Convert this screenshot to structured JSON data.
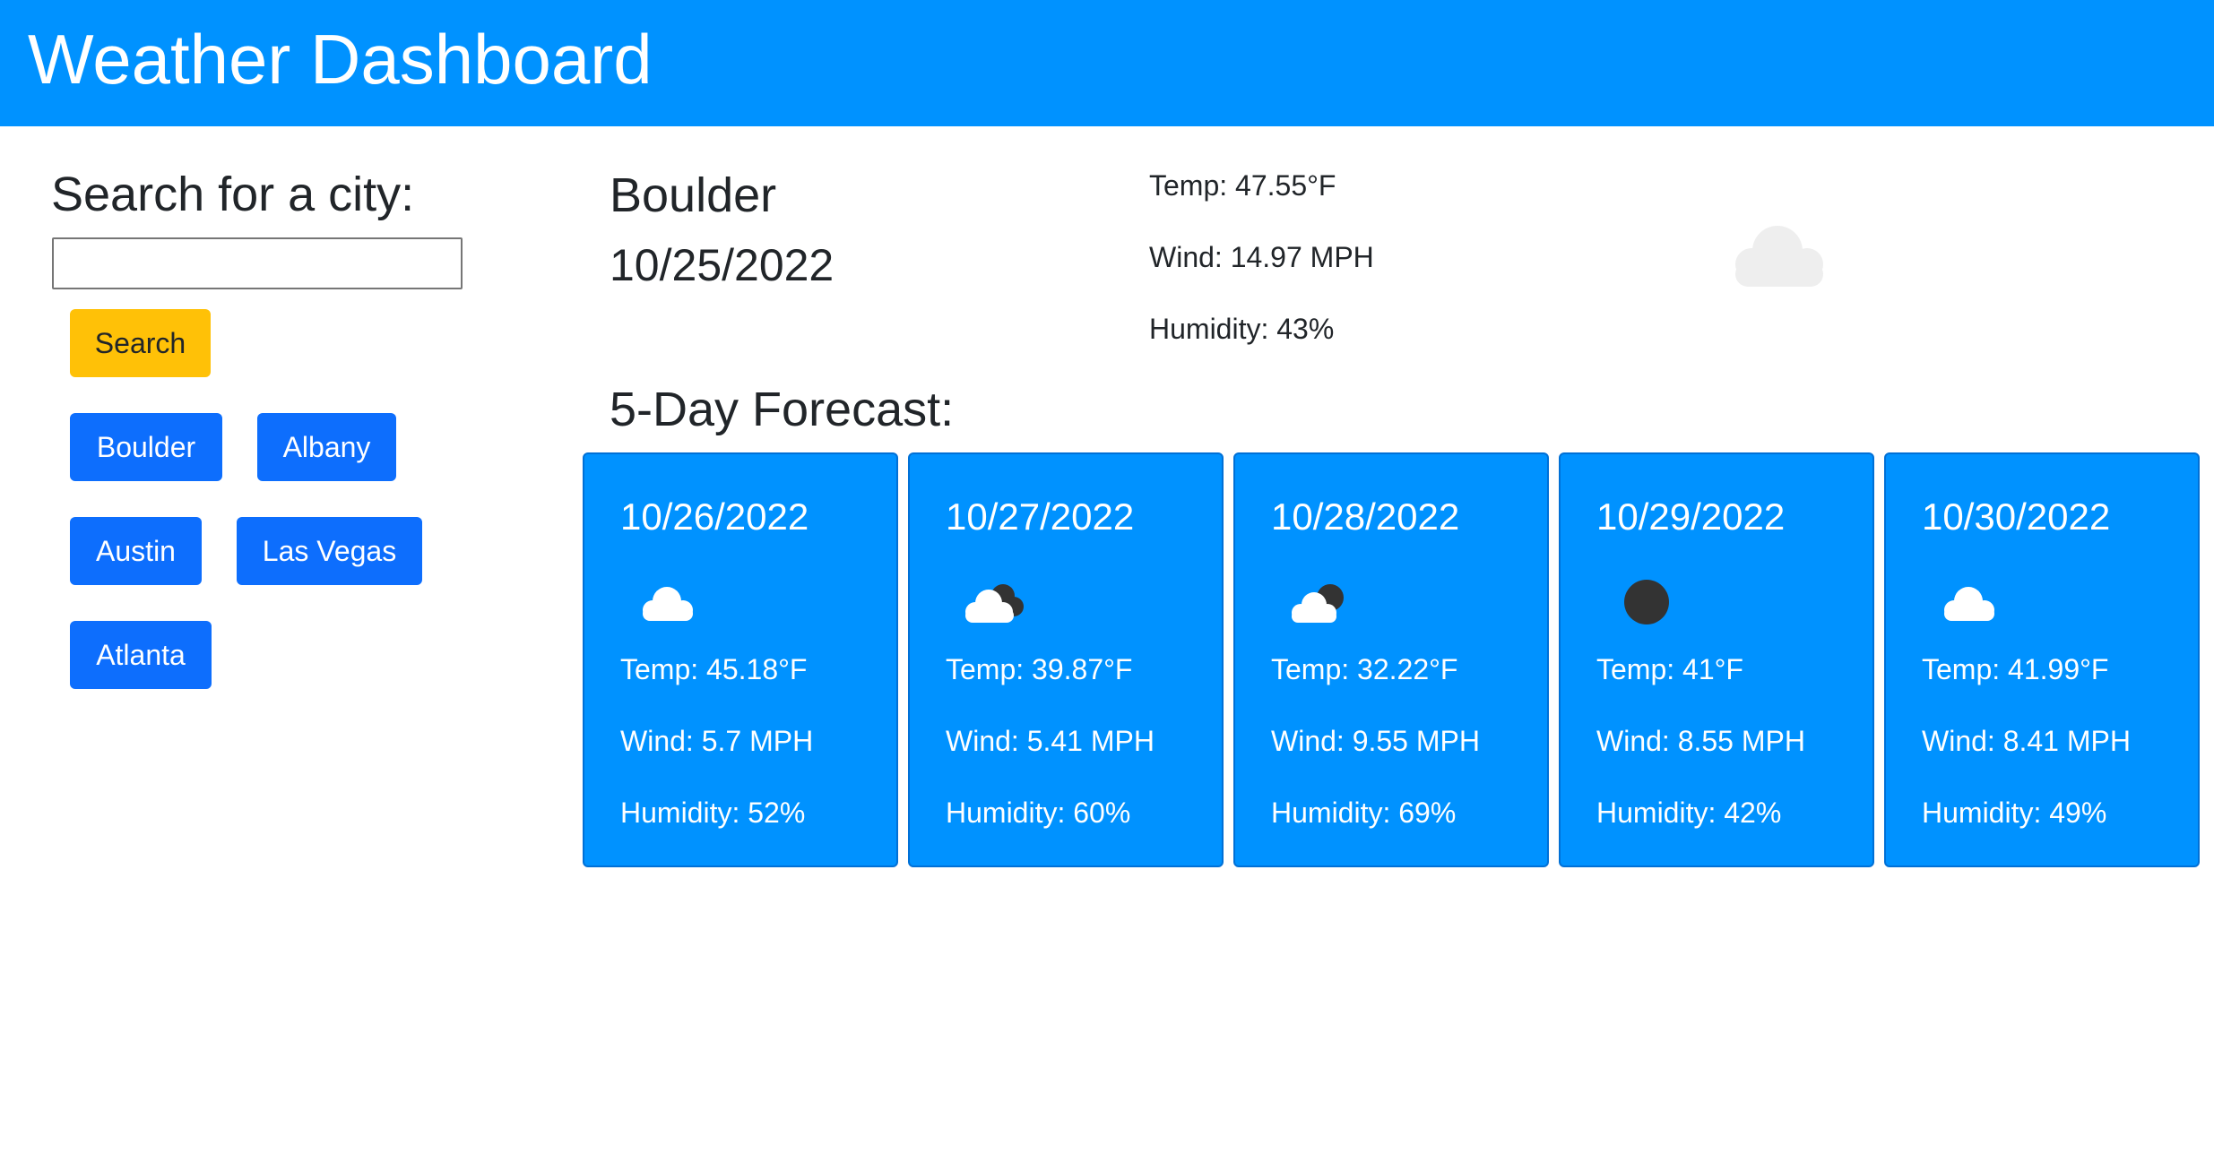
{
  "header": {
    "title": "Weather Dashboard"
  },
  "sidebar": {
    "search_title": "Search for a city:",
    "search_value": "",
    "search_button": "Search",
    "history": [
      "Boulder",
      "Albany",
      "Austin",
      "Las Vegas",
      "Atlanta"
    ]
  },
  "current": {
    "city": "Boulder",
    "date": "10/25/2022",
    "temp": "Temp: 47.55°F",
    "wind": "Wind: 14.97 MPH",
    "humidity": "Humidity: 43%",
    "icon": "cloud-icon"
  },
  "forecast": {
    "title": "5-Day Forecast:",
    "days": [
      {
        "date": "10/26/2022",
        "icon": "cloud-icon",
        "temp": "Temp: 45.18°F",
        "wind": "Wind: 5.7 MPH",
        "humidity": "Humidity: 52%"
      },
      {
        "date": "10/27/2022",
        "icon": "cloud-night-icon",
        "temp": "Temp: 39.87°F",
        "wind": "Wind: 5.41 MPH",
        "humidity": "Humidity: 60%"
      },
      {
        "date": "10/28/2022",
        "icon": "partly-cloudy-night-icon",
        "temp": "Temp: 32.22°F",
        "wind": "Wind: 9.55 MPH",
        "humidity": "Humidity: 69%"
      },
      {
        "date": "10/29/2022",
        "icon": "clear-night-icon",
        "temp": "Temp: 41°F",
        "wind": "Wind: 8.55 MPH",
        "humidity": "Humidity: 42%"
      },
      {
        "date": "10/30/2022",
        "icon": "cloud-icon",
        "temp": "Temp: 41.99°F",
        "wind": "Wind: 8.41 MPH",
        "humidity": "Humidity: 49%"
      }
    ]
  },
  "colors": {
    "header": "#0092ff",
    "card": "#0092ff",
    "city_button": "#0d6efd",
    "search_button": "#ffc107"
  }
}
